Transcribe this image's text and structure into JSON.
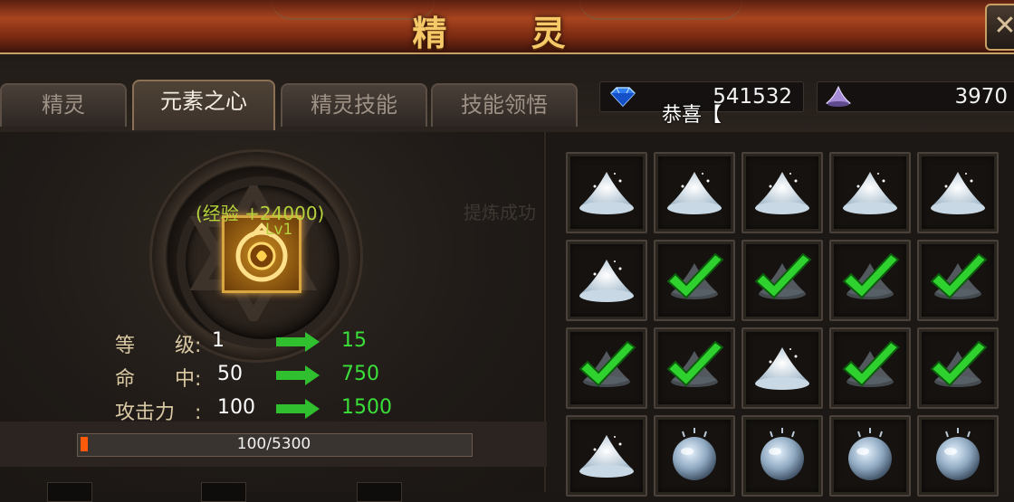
{
  "window": {
    "title": "精 灵",
    "close_label": "✕"
  },
  "tabs": [
    {
      "label": "精灵",
      "active": false
    },
    {
      "label": "元素之心",
      "active": true
    },
    {
      "label": "精灵技能",
      "active": false
    },
    {
      "label": "技能领悟",
      "active": false
    }
  ],
  "currency": {
    "diamond": {
      "icon": "blue-diamond-icon",
      "value": "541532"
    },
    "crystal": {
      "icon": "purple-crystal-icon",
      "value": "3970"
    }
  },
  "notice": {
    "congrats": "恭喜【",
    "faded": "提炼成功"
  },
  "element_heart": {
    "exp_gain": "(经验 +24000)",
    "level_badge": "Lv1",
    "icon": "element-heart-emblem-icon"
  },
  "stats": [
    {
      "label": "等　　级:",
      "current": "1",
      "next": "15"
    },
    {
      "label": "命　　中:",
      "current": "50",
      "next": "750"
    },
    {
      "label": "攻击力　:",
      "current": "100",
      "next": "1500"
    }
  ],
  "progress": {
    "text": "100/5300",
    "current": 100,
    "max": 5300
  },
  "colors": {
    "accent_gold": "#f5c968",
    "stat_green": "#3adf3a",
    "exp_green": "#b6d23c",
    "progress_fill": "#ff5a0a"
  },
  "grid": {
    "rows": [
      [
        "powder",
        "powder",
        "powder",
        "powder",
        "powder"
      ],
      [
        "powder",
        "checked",
        "checked",
        "checked",
        "checked"
      ],
      [
        "checked",
        "checked",
        "powder",
        "checked",
        "checked"
      ],
      [
        "powder",
        "orb",
        "orb",
        "orb",
        "orb"
      ]
    ]
  }
}
